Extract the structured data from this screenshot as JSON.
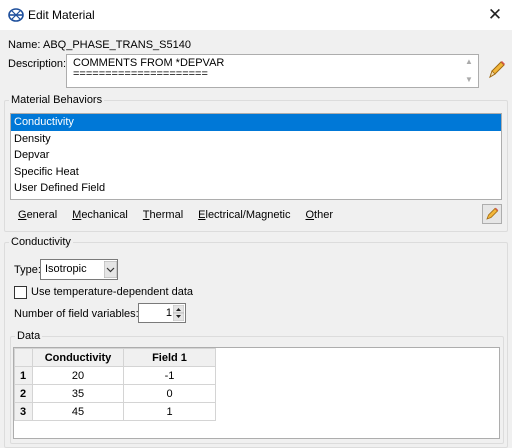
{
  "window": {
    "title": "Edit Material",
    "close_glyph": "✕"
  },
  "name_label": "Name:",
  "name_value": "ABQ_PHASE_TRANS_S5140",
  "description_label": "Description:",
  "description_value": "COMMENTS FROM *DEPVAR\n=====================",
  "material_behaviors": {
    "legend": "Material Behaviors",
    "items": [
      "Conductivity",
      "Density",
      "Depvar",
      "Specific Heat",
      "User Defined Field"
    ],
    "selected_index": 0
  },
  "menus": [
    {
      "u": "G",
      "rest": "eneral"
    },
    {
      "u": "M",
      "rest": "echanical"
    },
    {
      "u": "T",
      "rest": "hermal"
    },
    {
      "u": "E",
      "rest": "lectrical/Magnetic"
    },
    {
      "u": "O",
      "rest": "ther"
    }
  ],
  "conductivity": {
    "legend": "Conductivity",
    "type_label": "Type:",
    "type_value": "Isotropic",
    "temp_dependent_label": "Use temperature-dependent data",
    "temp_dependent_checked": false,
    "field_vars_label": "Number of field variables:",
    "field_vars_value": "1"
  },
  "data": {
    "legend": "Data",
    "columns": [
      "Conductivity",
      "Field 1"
    ],
    "rows": [
      {
        "index": "1",
        "conductivity": "20",
        "field1": "-1"
      },
      {
        "index": "2",
        "conductivity": "35",
        "field1": "0"
      },
      {
        "index": "3",
        "conductivity": "45",
        "field1": "1"
      }
    ]
  },
  "colors": {
    "selection": "#0078d7",
    "window_bg": "#f0f0f0"
  },
  "icons": [
    "material-dialog-icon",
    "pencil-icon",
    "edit-icon",
    "close-icon",
    "dropdown-arrow-icon",
    "spin-up-icon",
    "spin-down-icon"
  ]
}
